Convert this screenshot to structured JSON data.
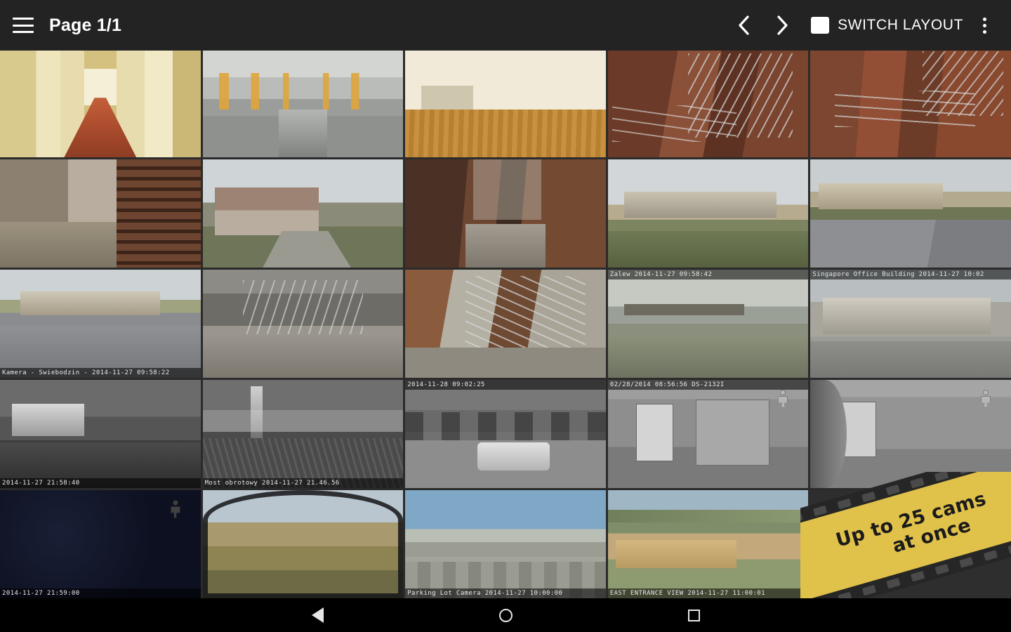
{
  "toolbar": {
    "menu_icon": "hamburger-menu-icon",
    "title": "Page 1/1",
    "prev_icon": "chevron-left-icon",
    "next_icon": "chevron-right-icon",
    "layout_icon": "single-layout-icon",
    "switch_layout_label": "SWITCH LAYOUT",
    "overflow_icon": "more-vert-icon"
  },
  "grid": {
    "columns": 5,
    "rows": 5,
    "tiles": [
      {
        "scene": "s-corridor-yellow",
        "osd": "",
        "osd_pos": "",
        "person": false
      },
      {
        "scene": "s-garage",
        "osd": "",
        "osd_pos": "",
        "person": false
      },
      {
        "scene": "s-room-wood",
        "osd": "",
        "osd_pos": "",
        "person": false
      },
      {
        "scene": "s-stair-brick",
        "osd": "",
        "osd_pos": "",
        "person": false
      },
      {
        "scene": "s-brick-wide",
        "osd": "",
        "osd_pos": "",
        "person": false
      },
      {
        "scene": "s-yard-wood",
        "osd": "",
        "osd_pos": "",
        "person": false
      },
      {
        "scene": "s-house-yard",
        "osd": "",
        "osd_pos": "",
        "person": false
      },
      {
        "scene": "s-alley",
        "osd": "",
        "osd_pos": "",
        "person": false
      },
      {
        "scene": "s-estate",
        "osd": "",
        "osd_pos": "",
        "person": false
      },
      {
        "scene": "s-street",
        "osd": "",
        "osd_pos": "",
        "person": false
      },
      {
        "scene": "s-road",
        "osd": "Kamera - Swiebodzin - 2014-11-27 09:58:22",
        "osd_pos": "bottom",
        "person": false
      },
      {
        "scene": "s-stairwell",
        "osd": "",
        "osd_pos": "",
        "person": false
      },
      {
        "scene": "s-balcony",
        "osd": "",
        "osd_pos": "",
        "person": false
      },
      {
        "scene": "s-lake",
        "osd": "Zalew 2014-11-27 09:58:42",
        "osd_pos": "top",
        "person": false
      },
      {
        "scene": "s-complex",
        "osd": "Singapore Office Building 2014-11-27 10:02",
        "osd_pos": "top",
        "person": false
      },
      {
        "scene": "s-night-house",
        "osd": "2014-11-27 21:58:40",
        "osd_pos": "bottom",
        "person": false
      },
      {
        "scene": "s-night-road",
        "osd": "Most obrotowy 2014-11-27 21.46.56",
        "osd_pos": "bottom",
        "person": false
      },
      {
        "scene": "s-night-park",
        "osd": "2014-11-28 09:02:25",
        "osd_pos": "top",
        "person": false
      },
      {
        "scene": "s-ir-door",
        "osd": "02/28/2014 08:56:56   DS-2132I",
        "osd_pos": "top",
        "person": true
      },
      {
        "scene": "s-ir-room",
        "osd": "",
        "osd_pos": "",
        "person": true
      },
      {
        "scene": "s-dark",
        "osd": "2014-11-27 21:59:00",
        "osd_pos": "bottom",
        "person": true
      },
      {
        "scene": "s-field1",
        "osd": "",
        "osd_pos": "",
        "person": false
      },
      {
        "scene": "s-airfield",
        "osd": "Parking Lot Camera 2014-11-27 10:00:00",
        "osd_pos": "bottom",
        "person": false
      },
      {
        "scene": "s-coast",
        "osd": "EAST ENTRANCE VIEW 2014-11-27 11:00:01",
        "osd_pos": "bottom",
        "person": false
      },
      {
        "scene": "empty",
        "osd": "",
        "osd_pos": "",
        "person": false
      }
    ]
  },
  "promo": {
    "line1": "Up to 25 cams",
    "line2": "at once",
    "background_color": "#E0C14A",
    "text_color": "#1b1b1b"
  },
  "navbar": {
    "back_icon": "back-triangle-icon",
    "home_icon": "home-circle-icon",
    "recents_icon": "recents-square-icon"
  },
  "colors": {
    "toolbar_bg": "#232323",
    "grid_gap": "#2b2b2b",
    "navbar_bg": "#000000",
    "accent": "#E0C14A"
  }
}
